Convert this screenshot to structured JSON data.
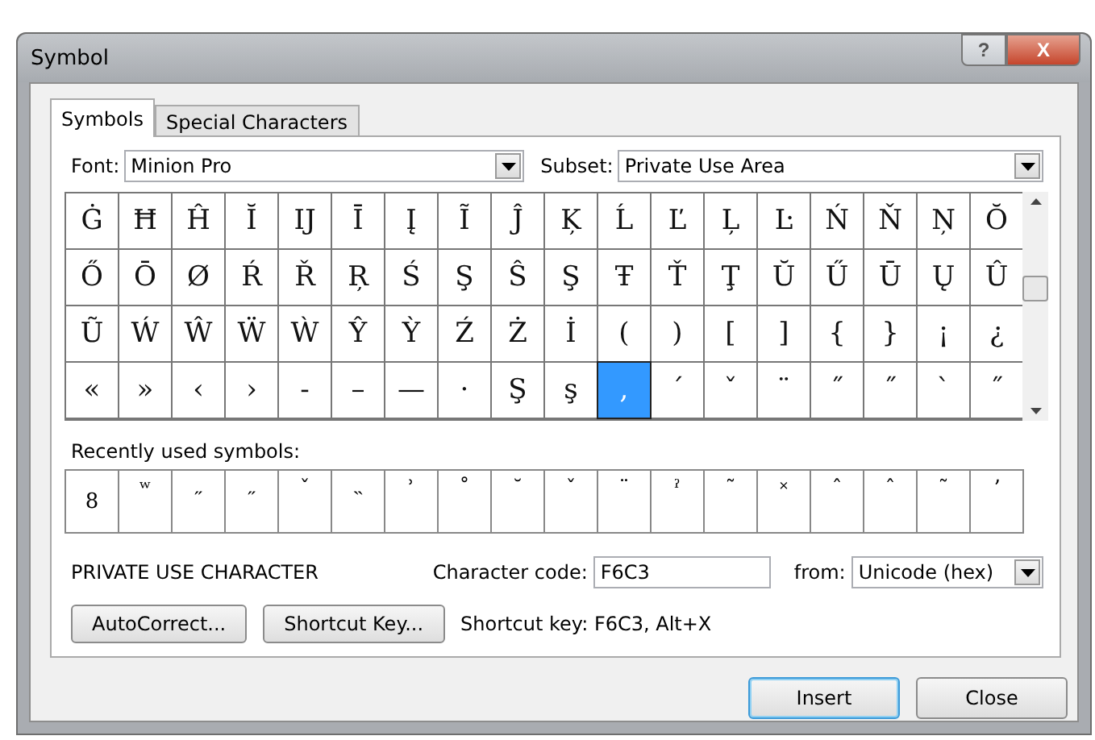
{
  "window": {
    "title": "Symbol",
    "help_button": "?",
    "close_button": "X"
  },
  "tabs": [
    {
      "label": "Symbols",
      "selected": true
    },
    {
      "label": "Special Characters",
      "selected": false
    }
  ],
  "font": {
    "label": "Font:",
    "value": "Minion Pro"
  },
  "subset": {
    "label": "Subset:",
    "value": "Private Use Area"
  },
  "symbols": [
    {
      "char": "Ġ",
      "selected": false
    },
    {
      "char": "Ħ",
      "selected": false
    },
    {
      "char": "Ĥ",
      "selected": false
    },
    {
      "char": "Ĭ",
      "selected": false
    },
    {
      "char": "Ĳ",
      "selected": false
    },
    {
      "char": "Ī",
      "selected": false
    },
    {
      "char": "Į",
      "selected": false
    },
    {
      "char": "Ĩ",
      "selected": false
    },
    {
      "char": "Ĵ",
      "selected": false
    },
    {
      "char": "Ķ",
      "selected": false
    },
    {
      "char": "Ĺ",
      "selected": false
    },
    {
      "char": "Ľ",
      "selected": false
    },
    {
      "char": "Ļ",
      "selected": false
    },
    {
      "char": "Ŀ",
      "selected": false
    },
    {
      "char": "Ń",
      "selected": false
    },
    {
      "char": "Ň",
      "selected": false
    },
    {
      "char": "Ņ",
      "selected": false
    },
    {
      "char": "Ŏ",
      "selected": false
    },
    {
      "char": "Ő",
      "selected": false
    },
    {
      "char": "Ō",
      "selected": false
    },
    {
      "char": "Ø",
      "selected": false
    },
    {
      "char": "Ŕ",
      "selected": false
    },
    {
      "char": "Ř",
      "selected": false
    },
    {
      "char": "Ŗ",
      "selected": false
    },
    {
      "char": "Ś",
      "selected": false
    },
    {
      "char": "Ş",
      "selected": false
    },
    {
      "char": "Ŝ",
      "selected": false
    },
    {
      "char": "Ş",
      "selected": false
    },
    {
      "char": "Ŧ",
      "selected": false
    },
    {
      "char": "Ť",
      "selected": false
    },
    {
      "char": "Ţ",
      "selected": false
    },
    {
      "char": "Ŭ",
      "selected": false
    },
    {
      "char": "Ű",
      "selected": false
    },
    {
      "char": "Ū",
      "selected": false
    },
    {
      "char": "Ų",
      "selected": false
    },
    {
      "char": "Û",
      "selected": false
    },
    {
      "char": "Ũ",
      "selected": false
    },
    {
      "char": "Ẃ",
      "selected": false
    },
    {
      "char": "Ŵ",
      "selected": false
    },
    {
      "char": "Ẅ",
      "selected": false
    },
    {
      "char": "Ẁ",
      "selected": false
    },
    {
      "char": "Ŷ",
      "selected": false
    },
    {
      "char": "Ỳ",
      "selected": false
    },
    {
      "char": "Ź",
      "selected": false
    },
    {
      "char": "Ż",
      "selected": false
    },
    {
      "char": "İ",
      "selected": false
    },
    {
      "char": "(",
      "selected": false
    },
    {
      "char": ")",
      "selected": false
    },
    {
      "char": "[",
      "selected": false
    },
    {
      "char": "]",
      "selected": false
    },
    {
      "char": "{",
      "selected": false
    },
    {
      "char": "}",
      "selected": false
    },
    {
      "char": "¡",
      "selected": false
    },
    {
      "char": "¿",
      "selected": false
    },
    {
      "char": "«",
      "selected": false
    },
    {
      "char": "»",
      "selected": false
    },
    {
      "char": "‹",
      "selected": false
    },
    {
      "char": "›",
      "selected": false
    },
    {
      "char": "-",
      "selected": false
    },
    {
      "char": "–",
      "selected": false
    },
    {
      "char": "—",
      "selected": false
    },
    {
      "char": "·",
      "selected": false
    },
    {
      "char": "Ş",
      "selected": false
    },
    {
      "char": "ş",
      "selected": false
    },
    {
      "char": ",",
      "selected": true
    },
    {
      "char": "ˊ",
      "selected": false
    },
    {
      "char": "ˇ",
      "selected": false
    },
    {
      "char": "¨",
      "selected": false
    },
    {
      "char": "˝",
      "selected": false
    },
    {
      "char": "˝",
      "selected": false
    },
    {
      "char": "ˋ",
      "selected": false
    },
    {
      "char": "˝",
      "selected": false
    }
  ],
  "recent": {
    "label": "Recently used symbols:",
    "symbols": [
      "8",
      "ʷ",
      "˶",
      "˶",
      "ˇ",
      "˵",
      "ʾ",
      "˚",
      "˘",
      "ˇ",
      "¨",
      "ˀ",
      "˜",
      "˟",
      "ˆ",
      "ˆ",
      "˜",
      "ʼ"
    ]
  },
  "description": "PRIVATE USE CHARACTER",
  "character_code": {
    "label": "Character code:",
    "value": "F6C3"
  },
  "from": {
    "label": "from:",
    "value": "Unicode (hex)"
  },
  "buttons_left": [
    "AutoCorrect...",
    "Shortcut Key..."
  ],
  "shortcut_text": "Shortcut key: F6C3, Alt+X",
  "buttons": [
    {
      "label": "Insert",
      "default": true
    },
    {
      "label": "Close",
      "default": false
    }
  ]
}
